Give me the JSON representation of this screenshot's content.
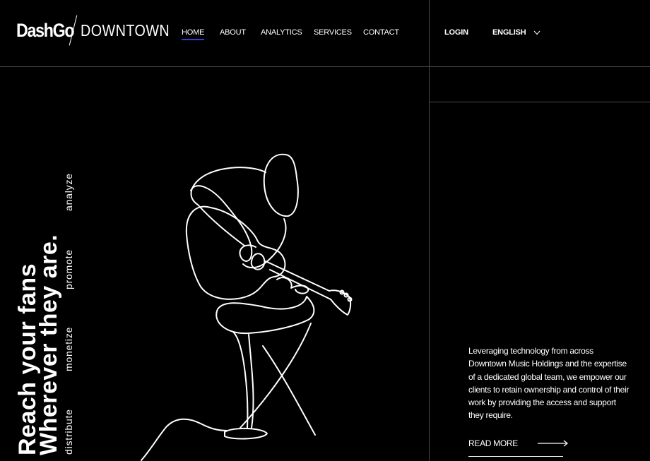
{
  "logo": {
    "brand": "DashGo",
    "division": "DOWNTOWN"
  },
  "nav": {
    "items": [
      {
        "label": "HOME",
        "active": true
      },
      {
        "label": "ABOUT"
      },
      {
        "label": "ANALYTICS"
      },
      {
        "label": "SERVICES"
      },
      {
        "label": "CONTACT"
      }
    ],
    "accent": "#3b3bd6"
  },
  "header": {
    "login": "LOGIN",
    "language": "ENGLISH"
  },
  "hero": {
    "line1": "Reach your fans",
    "line2": "Wherever they are.",
    "verbs": [
      "distribute",
      "monetize",
      "promote",
      "analyze"
    ]
  },
  "side": {
    "description": "Leveraging technology from across Downtown Music Holdings and the expertise of a dedicated global team, we empower our clients to retain ownership and control of their work by providing the access and support they require.",
    "read_more": "READ MORE"
  },
  "icons": {
    "language": "chevron-down-icon",
    "read_more": "long-arrow-right-icon",
    "art": "guitarist-line-art"
  },
  "colors": {
    "background": "#000000",
    "text": "#ffffff",
    "divider": "#4a4a4a"
  }
}
